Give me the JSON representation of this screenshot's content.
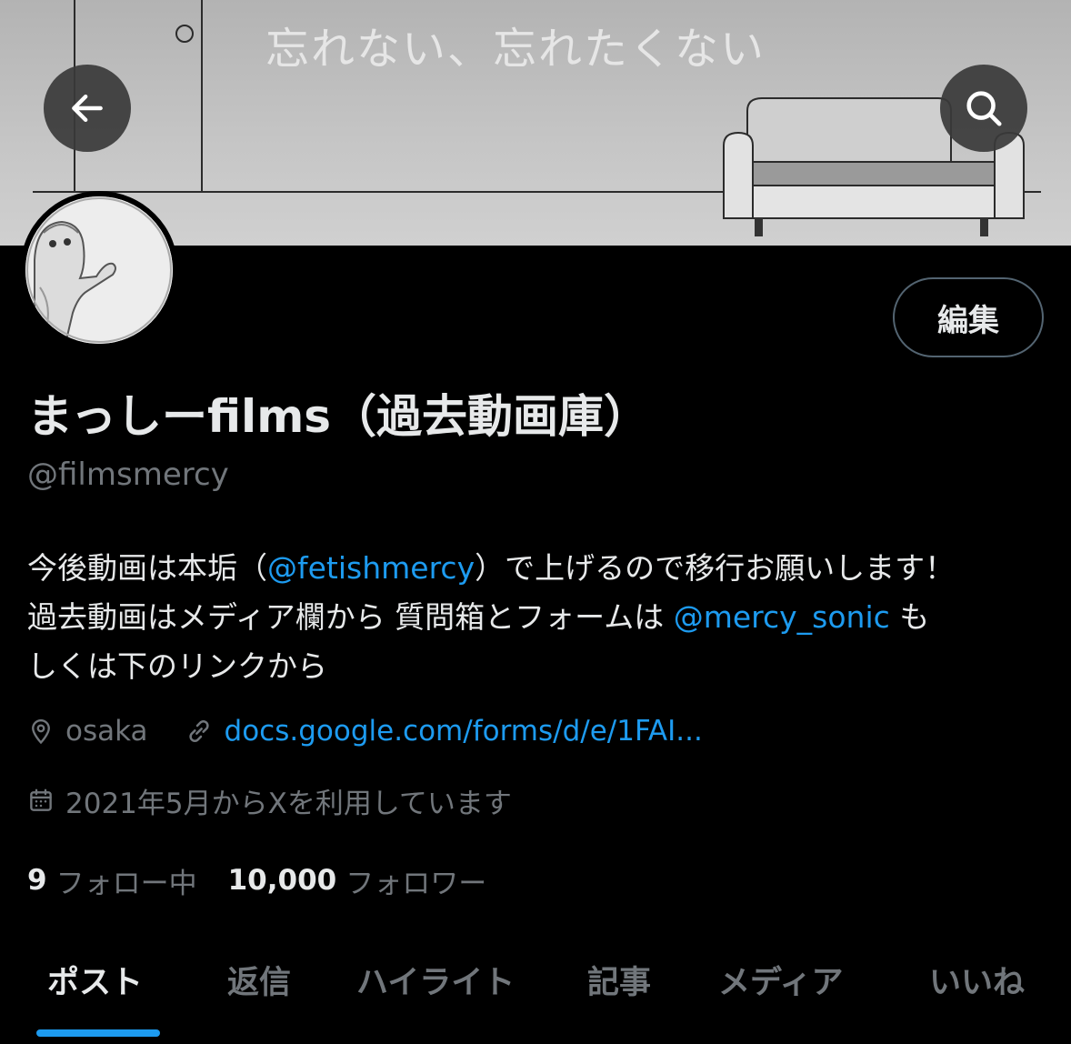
{
  "banner": {
    "text": "忘れない、忘れたくない"
  },
  "nav": {
    "back_icon": "arrow-left-icon",
    "search_icon": "search-icon"
  },
  "profile": {
    "edit_label": "編集",
    "display_name": "まっしーfilms（過去動画庫）",
    "handle": "@filmsmercy"
  },
  "bio": {
    "line1_before": "今後動画は本垢（",
    "line1_mention": "@fetishmercy",
    "line1_after": "）で上げるので移行お願いします！",
    "line2_before": "過去動画はメディア欄から 質問箱とフォームは ",
    "line2_mention": "@mercy_sonic",
    "line2_after": " も",
    "line3": "しくは下のリンクから"
  },
  "meta": {
    "location_icon": "location-pin-icon",
    "location": "osaka",
    "link_icon": "link-icon",
    "url": "docs.google.com/forms/d/e/1FAI...",
    "calendar_icon": "calendar-icon",
    "joined": "2021年5月からXを利用しています"
  },
  "stats": {
    "following_count": "9",
    "following_label": "フォロー中",
    "followers_count": "10,000",
    "followers_label": "フォロワー"
  },
  "tabs": [
    "ポスト",
    "返信",
    "ハイライト",
    "記事",
    "メディア",
    "いいね"
  ],
  "colors": {
    "accent": "#1d9bf0",
    "background": "#000000",
    "text_primary": "#e7e9ea",
    "text_secondary": "#71767b"
  }
}
